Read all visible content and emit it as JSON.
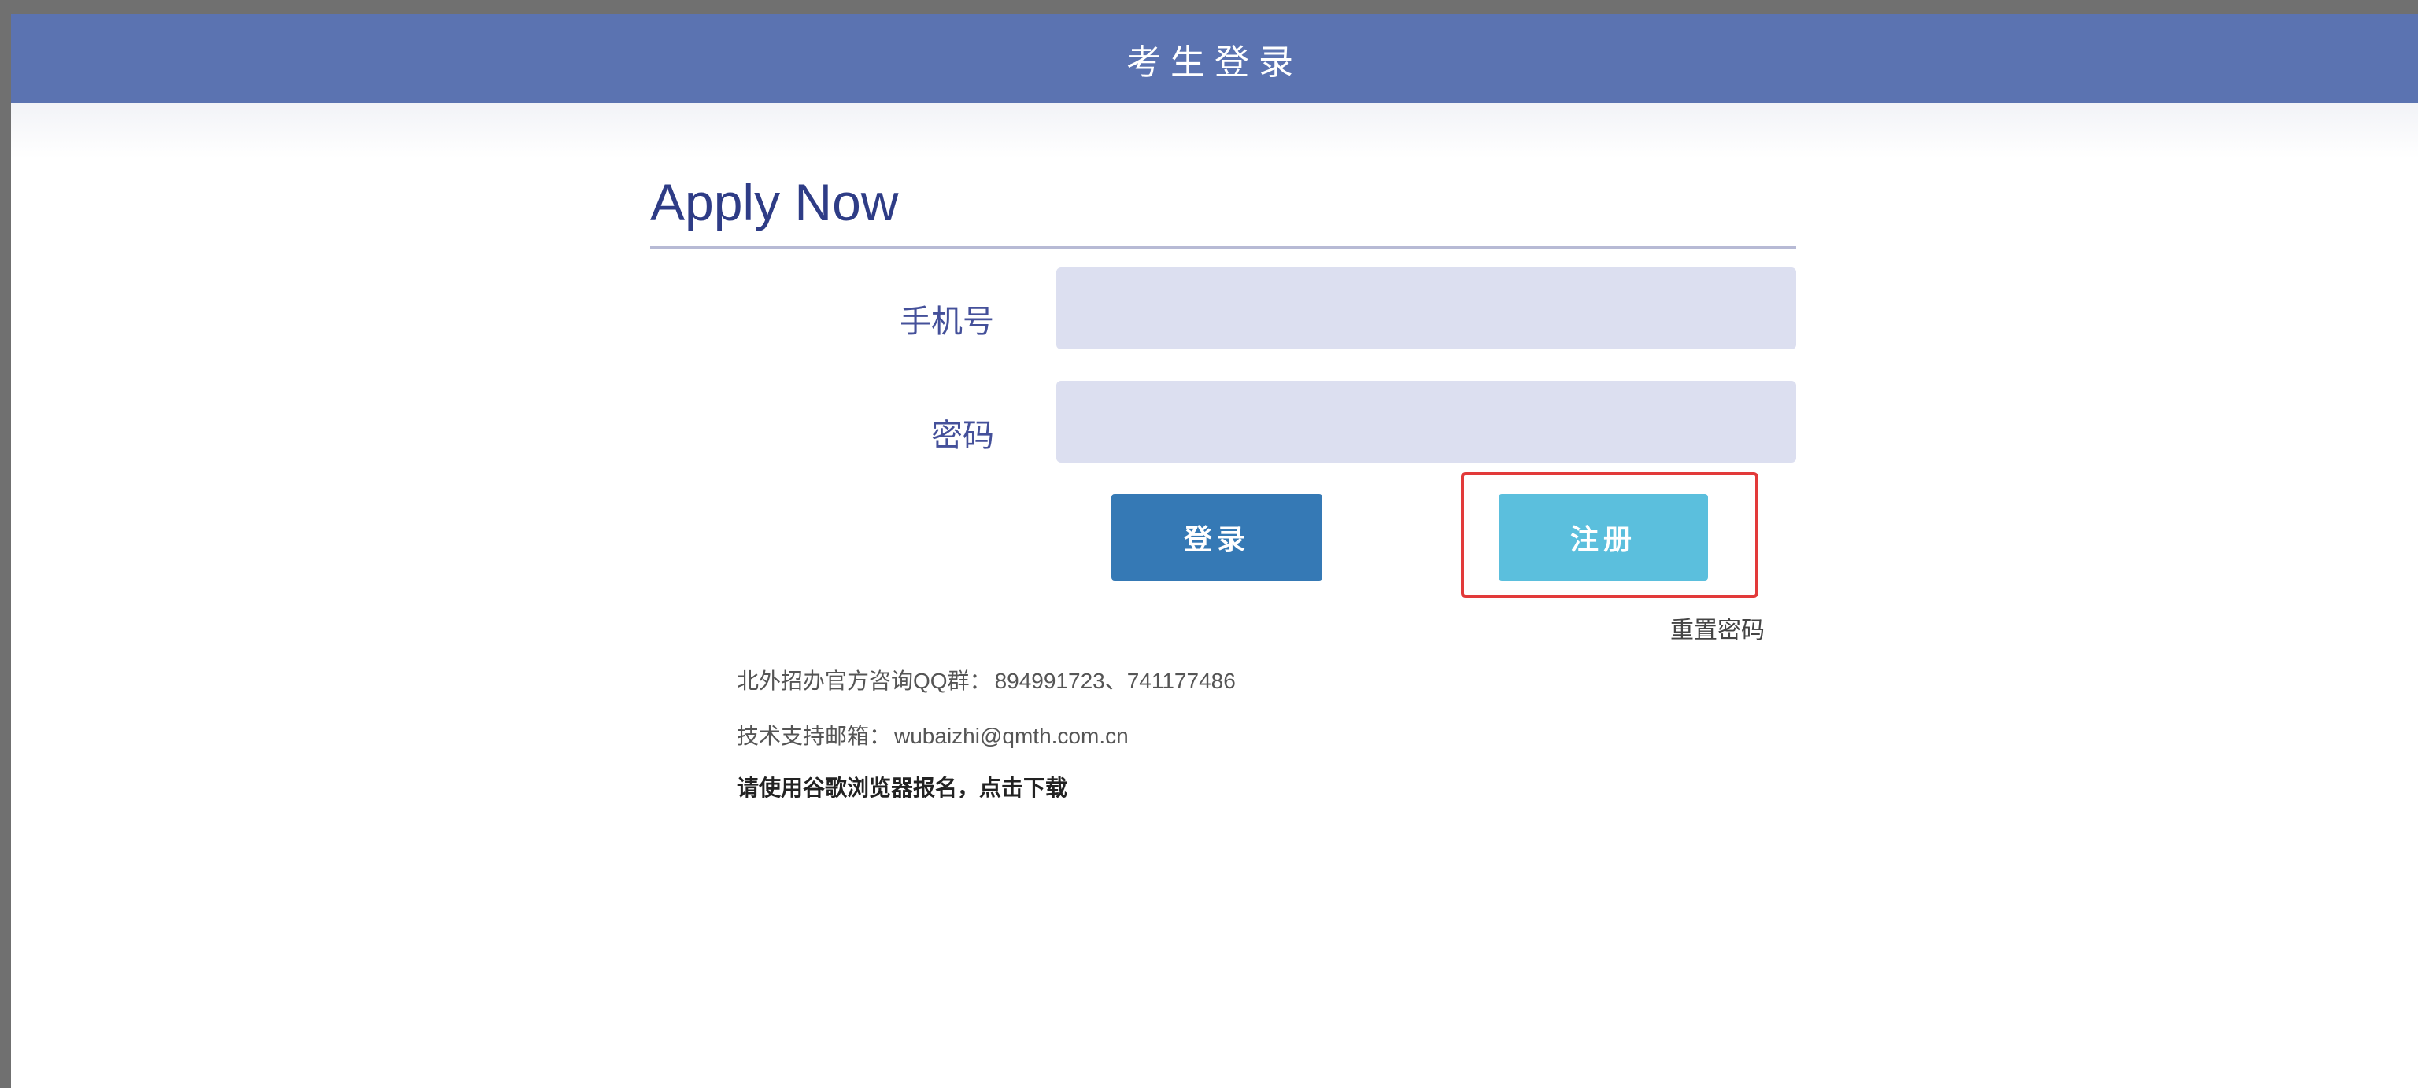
{
  "header": {
    "title": "考生登录"
  },
  "form": {
    "heading": "Apply Now",
    "phone": {
      "label": "手机号",
      "value": "",
      "placeholder": ""
    },
    "password": {
      "label": "密码",
      "value": "",
      "placeholder": ""
    },
    "login_label": "登录",
    "register_label": "注册",
    "reset_label": "重置密码"
  },
  "info": {
    "qq_label": "北外招办官方咨询QQ群：",
    "qq_value": "894991723、741177486",
    "email_label": "技术支持邮箱：",
    "email_value": "wubaizhi@qmth.com.cn",
    "download_text": "请使用谷歌浏览器报名，点击下载"
  },
  "colors": {
    "header_bg": "#5b73b1",
    "heading": "#2e3c86",
    "input_bg": "#dcdff0",
    "login_button": "#3579b5",
    "register_button": "#5bbfdd",
    "highlight_border": "#e23a3a"
  }
}
